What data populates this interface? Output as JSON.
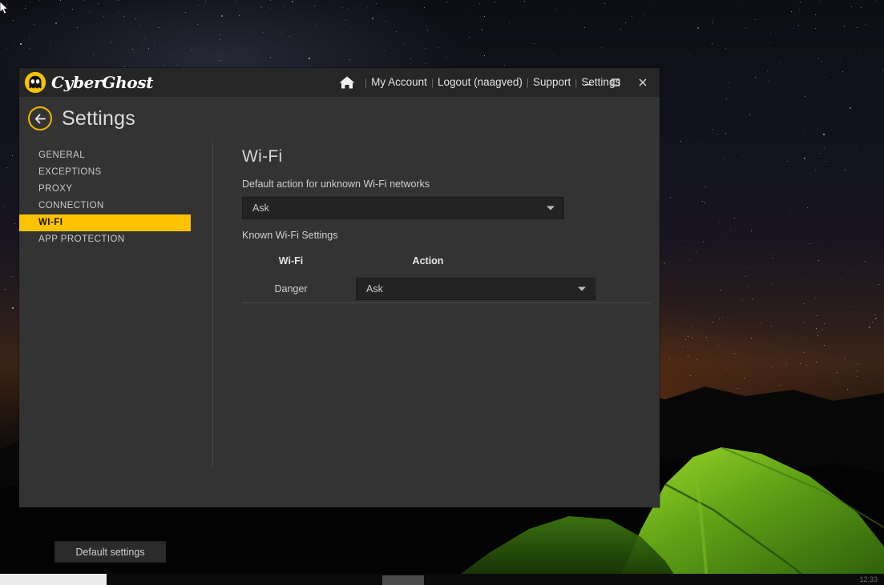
{
  "window": {
    "brand": "CyberGhost",
    "logo_icon": "cyberghost-logo-icon",
    "titlebar": {
      "home_icon": "home-icon",
      "links": [
        {
          "label": "My Account",
          "name": "my-account-link"
        },
        {
          "label": "Logout (naagved)",
          "name": "logout-link"
        },
        {
          "label": "Support",
          "name": "support-link"
        },
        {
          "label": "Settings",
          "name": "settings-link"
        }
      ],
      "separator": "|",
      "controls": {
        "minimize": "minimize-icon",
        "maximize": "maximize-icon",
        "close": "close-icon"
      }
    },
    "header": {
      "back_icon": "back-arrow-icon",
      "title": "Settings"
    }
  },
  "sidebar": {
    "items": [
      {
        "label": "GENERAL",
        "name": "sidebar-item-general",
        "active": false
      },
      {
        "label": "EXCEPTIONS",
        "name": "sidebar-item-exceptions",
        "active": false
      },
      {
        "label": "PROXY",
        "name": "sidebar-item-proxy",
        "active": false
      },
      {
        "label": "CONNECTION",
        "name": "sidebar-item-connection",
        "active": false
      },
      {
        "label": "WI-FI",
        "name": "sidebar-item-wifi",
        "active": true
      },
      {
        "label": "APP PROTECTION",
        "name": "sidebar-item-app-protection",
        "active": false
      }
    ]
  },
  "content": {
    "heading": "Wi-Fi",
    "default_action_label": "Default action for unknown Wi-Fi networks",
    "default_action_value": "Ask",
    "known_settings_label": "Known Wi-Fi Settings",
    "table": {
      "headers": [
        "Wi-Fi",
        "Action"
      ],
      "rows": [
        {
          "wifi": "Danger",
          "action": "Ask"
        }
      ]
    }
  },
  "footer": {
    "default_settings_label": "Default settings"
  },
  "taskbar": {
    "clock": "12:33"
  },
  "colors": {
    "accent_yellow": "#fdc300",
    "brand_yellow": "#f5c400",
    "window_bg": "#333333",
    "titlebar_bg": "#262626",
    "input_bg": "#232323"
  }
}
